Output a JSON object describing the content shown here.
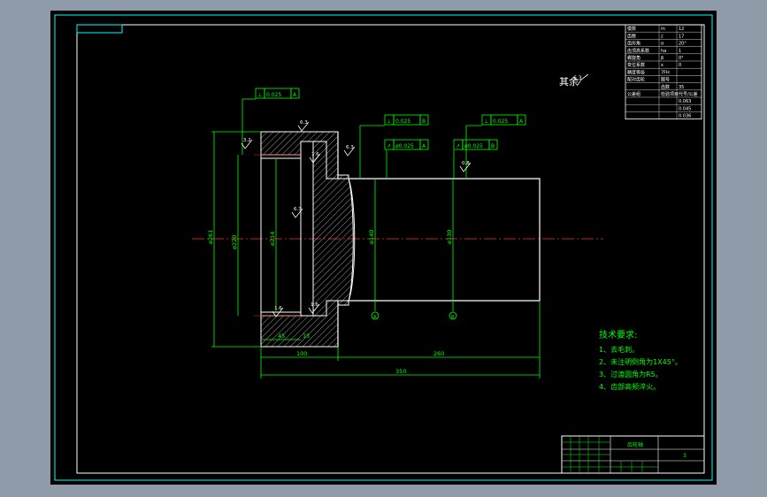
{
  "window": {
    "viewport_bg": "#8f9ba8",
    "sheet_bg": "#000000"
  },
  "colors": {
    "outline": "#ffffff",
    "dimension": "#00ff00",
    "centerline": "#ff2a2a",
    "frame": "#00ffff",
    "hatch": "#ffffff"
  },
  "drawing": {
    "surface_finish_note": "其余",
    "surface_finish_value": "6.3",
    "roughness_marks": [
      "6.3",
      "6.3",
      "3.2",
      "6.3",
      "1.6",
      "0.8",
      "1.6",
      "1.6"
    ],
    "datum_labels": [
      "A",
      "B"
    ],
    "tolerance_frames": [
      {
        "symbol": "⊥",
        "value": "0.025",
        "datum": "A"
      },
      {
        "symbol": "⊥",
        "value": "0.025",
        "datum": "B"
      },
      {
        "symbol": "⊥",
        "value": "0.025",
        "datum": "A"
      },
      {
        "symbol": "↗",
        "value": "ø0.025",
        "datum": "A"
      },
      {
        "symbol": "↗",
        "value": "ø0.025",
        "datum": "B"
      }
    ],
    "dimensions": {
      "length_flange": "100",
      "length_shaft": "260",
      "length_total": "350",
      "dia_outer": "ø261",
      "dia_flange_bore": "ø220",
      "dia_inner": "ø214",
      "dia_body": "ø140",
      "dia_shaft": "ø130",
      "chamfer_small": "45",
      "step_small": "15"
    }
  },
  "tech_requirements": {
    "heading": "技术要求:",
    "items": [
      "1、去毛刺。",
      "2、未注明倒角为1X45°。",
      "3、过渡圆角为R5。",
      "4、齿部高频淬火。"
    ]
  },
  "gear_table": {
    "rows": [
      [
        "模数",
        "m",
        "12"
      ],
      [
        "齿数",
        "z",
        "17"
      ],
      [
        "齿形角",
        "α",
        "20°"
      ],
      [
        "齿顶高系数",
        "ha",
        "1"
      ],
      [
        "螺旋角",
        "β",
        "0°"
      ],
      [
        "变位系数",
        "x",
        "0"
      ],
      [
        "精度等级",
        "7FH",
        ""
      ],
      [
        "配对齿轮",
        "图号",
        ""
      ],
      [
        "",
        "齿数",
        "35"
      ],
      [
        "公差组",
        "检验项目",
        "代号/公差"
      ],
      [
        "",
        "",
        "0.063"
      ],
      [
        "",
        "",
        "0.045"
      ],
      [
        "",
        "",
        "0.036"
      ]
    ]
  },
  "title_block": {
    "part_name": "齿轮轴",
    "drawing_no": "3"
  }
}
